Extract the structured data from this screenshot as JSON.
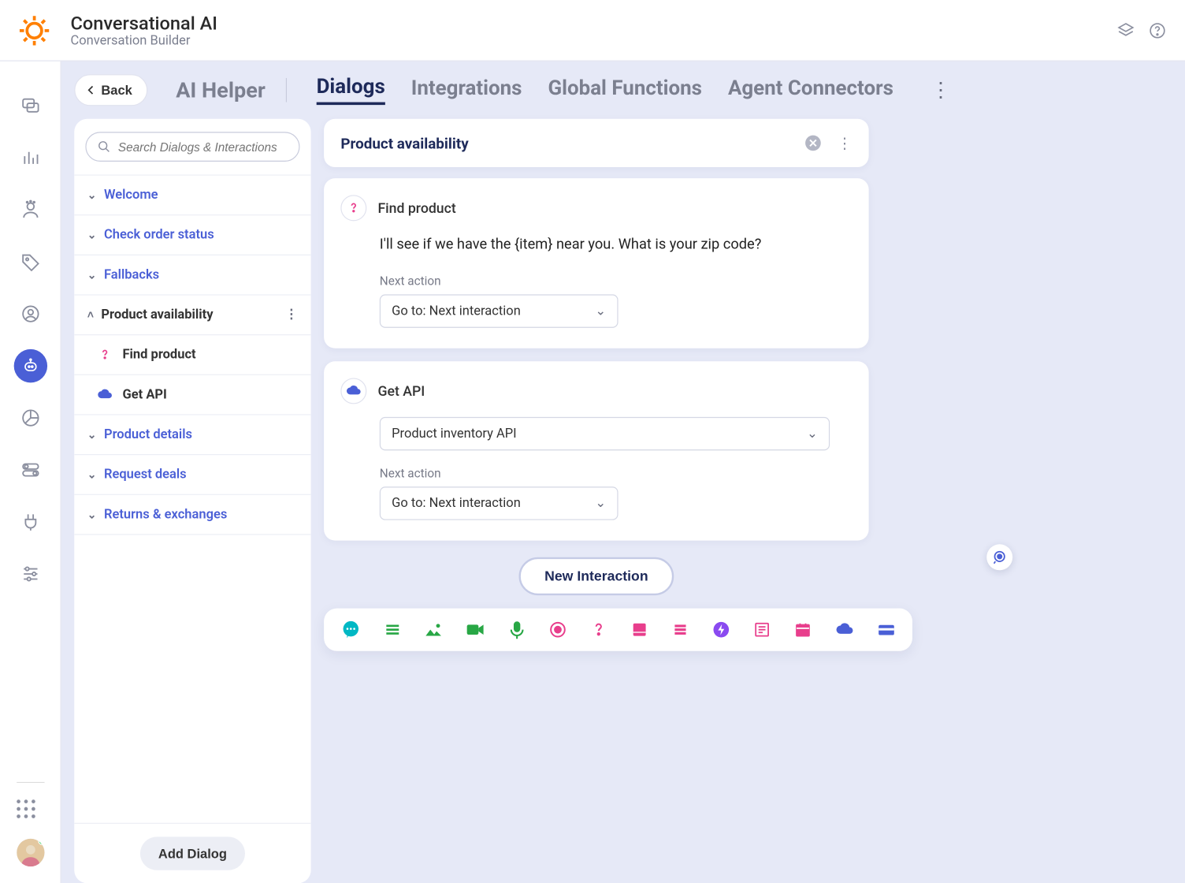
{
  "header": {
    "title": "Conversational AI",
    "subtitle": "Conversation Builder"
  },
  "topActions": {
    "back": "Back"
  },
  "tabs": {
    "ai_helper": "AI Helper",
    "items": [
      "Dialogs",
      "Integrations",
      "Global Functions",
      "Agent Connectors"
    ],
    "active_index": 0
  },
  "sidebar": {
    "search_placeholder": "Search Dialogs & Interactions",
    "dialogs": [
      {
        "label": "Welcome",
        "expanded": false
      },
      {
        "label": "Check order status",
        "expanded": false
      },
      {
        "label": "Fallbacks",
        "expanded": false
      },
      {
        "label": "Product availability",
        "expanded": true,
        "children": [
          {
            "label": "Find product",
            "icon": "question"
          },
          {
            "label": "Get API",
            "icon": "cloud"
          }
        ]
      },
      {
        "label": "Product details",
        "expanded": false
      },
      {
        "label": "Request deals",
        "expanded": false
      },
      {
        "label": "Returns & exchanges",
        "expanded": false
      }
    ],
    "add_dialog": "Add Dialog"
  },
  "canvas": {
    "dialog_title": "Product availability",
    "interactions": [
      {
        "name": "Find product",
        "icon": "question",
        "body": "I'll see if we have the {item} near you. What is your zip code?",
        "next_action_label": "Next action",
        "next_action_value": "Go to: Next interaction"
      },
      {
        "name": "Get API",
        "icon": "cloud",
        "api_value": "Product inventory API",
        "next_action_label": "Next action",
        "next_action_value": "Go to: Next interaction"
      }
    ],
    "new_interaction": "New Interaction"
  },
  "colors": {
    "accent": "#4a5fd6",
    "pink": "#e83e8c",
    "orange": "#ff7f00",
    "teal": "#00b8c4",
    "green": "#28a745",
    "purple": "#8a4af0",
    "navy": "#1e2a5a"
  }
}
